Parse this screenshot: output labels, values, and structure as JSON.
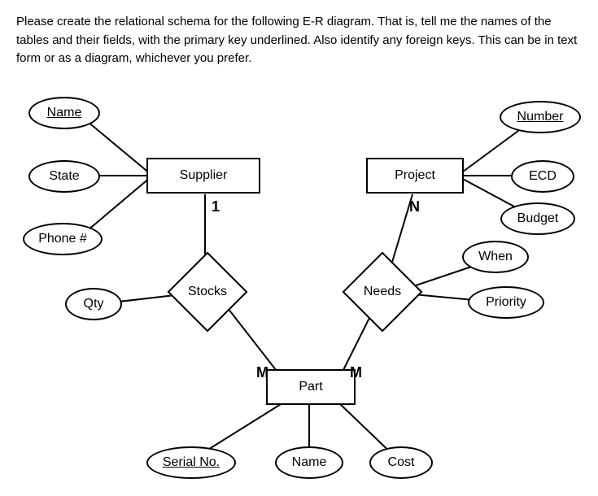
{
  "instruction": "Please create the relational schema for the following E-R diagram. That is, tell me the names of the tables and their fields, with the primary key underlined. Also identify any foreign keys. This can be in text form or as a diagram, whichever you prefer.",
  "entities": {
    "supplier": {
      "label": "Supplier"
    },
    "project": {
      "label": "Project"
    },
    "part": {
      "label": "Part"
    }
  },
  "attributes": {
    "supplier_name": {
      "label": "Name",
      "key": true
    },
    "supplier_state": {
      "label": "State",
      "key": false
    },
    "supplier_phone": {
      "label": "Phone #",
      "key": false
    },
    "project_number": {
      "label": "Number",
      "key": true
    },
    "project_ecd": {
      "label": "ECD",
      "key": false
    },
    "project_budget": {
      "label": "Budget",
      "key": false
    },
    "needs_when": {
      "label": "When",
      "key": false
    },
    "needs_priority": {
      "label": "Priority",
      "key": false
    },
    "stocks_qty": {
      "label": "Qty",
      "key": false
    },
    "part_serial": {
      "label": "Serial No.",
      "key": true
    },
    "part_name": {
      "label": "Name",
      "key": false
    },
    "part_cost": {
      "label": "Cost",
      "key": false
    }
  },
  "relationships": {
    "stocks": {
      "label": "Stocks"
    },
    "needs": {
      "label": "Needs"
    }
  },
  "cardinalities": {
    "stocks_supplier": "1",
    "stocks_part": "M",
    "needs_project": "N",
    "needs_part": "M"
  },
  "chart_data": {
    "type": "er-diagram",
    "entities": [
      {
        "name": "Supplier",
        "attributes": [
          {
            "name": "Name",
            "primary_key": true
          },
          {
            "name": "State",
            "primary_key": false
          },
          {
            "name": "Phone #",
            "primary_key": false
          }
        ]
      },
      {
        "name": "Project",
        "attributes": [
          {
            "name": "Number",
            "primary_key": true
          },
          {
            "name": "ECD",
            "primary_key": false
          },
          {
            "name": "Budget",
            "primary_key": false
          }
        ]
      },
      {
        "name": "Part",
        "attributes": [
          {
            "name": "Serial No.",
            "primary_key": true
          },
          {
            "name": "Name",
            "primary_key": false
          },
          {
            "name": "Cost",
            "primary_key": false
          }
        ]
      }
    ],
    "relationships": [
      {
        "name": "Stocks",
        "between": [
          "Supplier",
          "Part"
        ],
        "cardinality": {
          "Supplier": "1",
          "Part": "M"
        },
        "attributes": [
          "Qty"
        ]
      },
      {
        "name": "Needs",
        "between": [
          "Project",
          "Part"
        ],
        "cardinality": {
          "Project": "N",
          "Part": "M"
        },
        "attributes": [
          "When",
          "Priority"
        ]
      }
    ]
  }
}
